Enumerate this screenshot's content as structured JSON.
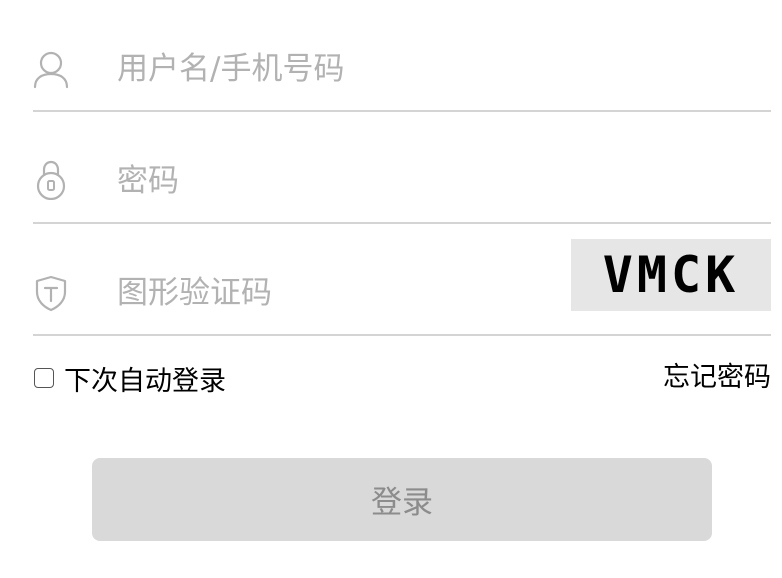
{
  "form": {
    "username": {
      "placeholder": "用户名/手机号码",
      "value": "",
      "icon": "user-icon"
    },
    "password": {
      "placeholder": "密码",
      "value": "",
      "icon": "lock-icon"
    },
    "captcha": {
      "placeholder": "图形验证码",
      "value": "",
      "icon": "shield-icon",
      "image_text": "VMCK"
    },
    "remember_label": "下次自动登录",
    "remember_checked": false,
    "forgot_label": "忘记密码",
    "submit_label": "登录"
  },
  "colors": {
    "divider": "#d4d4d4",
    "placeholder": "#b2b2b2",
    "icon": "#b2b2b2",
    "button_bg": "#d9d9d9",
    "button_text": "#8c8c8c",
    "captcha_bg": "#e6e6e6"
  }
}
